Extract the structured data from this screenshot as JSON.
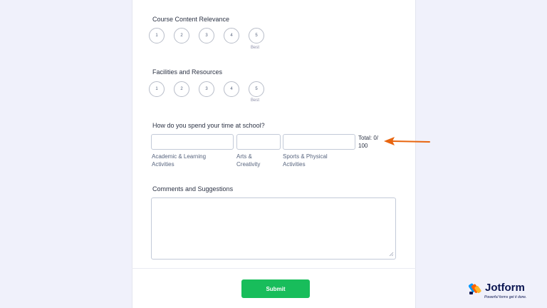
{
  "form": {
    "q1": {
      "label": "Course Content Relevance",
      "options": [
        "1",
        "2",
        "3",
        "4",
        "5"
      ],
      "high_caption": "Best"
    },
    "q2": {
      "label": "Facilities and Resources",
      "options": [
        "1",
        "2",
        "3",
        "4",
        "5"
      ],
      "high_caption": "Best"
    },
    "q3": {
      "label": "How do you spend your time at school?",
      "fields": [
        {
          "value": "",
          "sublabel": "Academic & Learning Activities"
        },
        {
          "value": "",
          "sublabel": "Arts & Creativity"
        },
        {
          "value": "",
          "sublabel": "Sports & Physical Activities"
        }
      ],
      "total_text": "Total:  0/ 100"
    },
    "q4": {
      "label": "Comments and Suggestions",
      "value": ""
    },
    "submit_label": "Submit"
  },
  "branding": {
    "logo_text": "Jotform",
    "tagline": "Powerful forms get it done."
  },
  "colors": {
    "background": "#f0f1fb",
    "submit": "#18bd5b",
    "arrow": "#e8650f",
    "logo": "#0a1551"
  }
}
